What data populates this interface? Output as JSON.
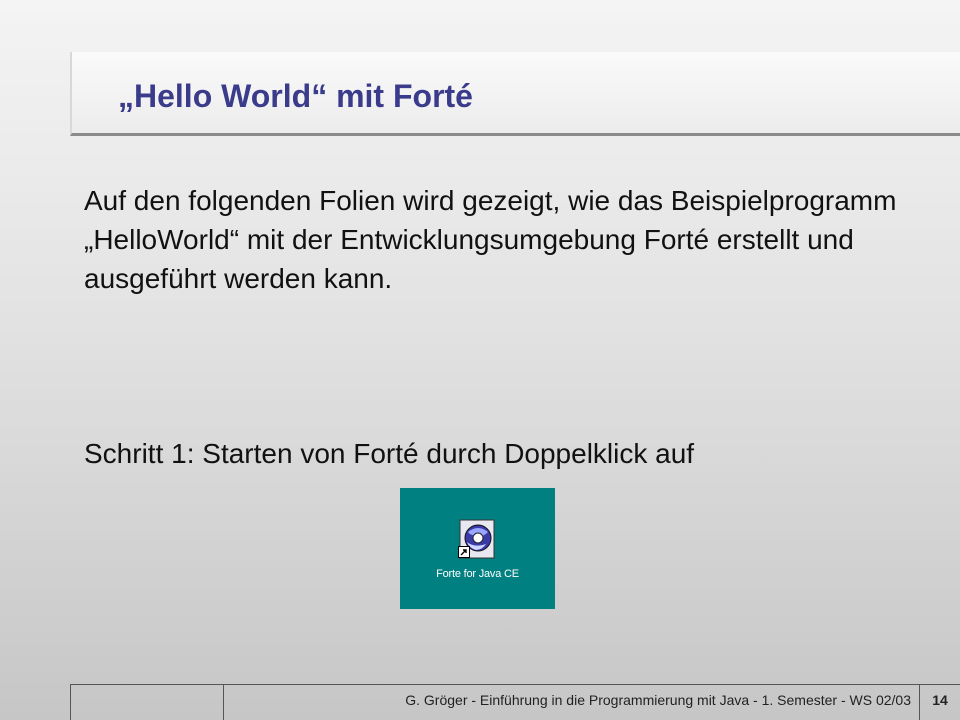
{
  "slide": {
    "title": "„Hello World“ mit Forté",
    "body": "Auf den folgenden Folien wird gezeigt, wie das Beispielprogramm „HelloWorld“ mit der Entwicklungsumgebung Forté erstellt und ausgeführt werden kann.",
    "step": "Schritt 1: Starten von Forté durch Doppelklick auf"
  },
  "desktop_icon": {
    "label": "Forte for Java CE",
    "icon": "forte-for-java-icon",
    "background": "#008080"
  },
  "footer": {
    "text": "G. Gröger  -  Einführung in die Programmierung mit Java  -  1. Semester  -  WS 02/03",
    "page": "14"
  },
  "colors": {
    "title": "#3b3b8c",
    "text": "#111111"
  }
}
